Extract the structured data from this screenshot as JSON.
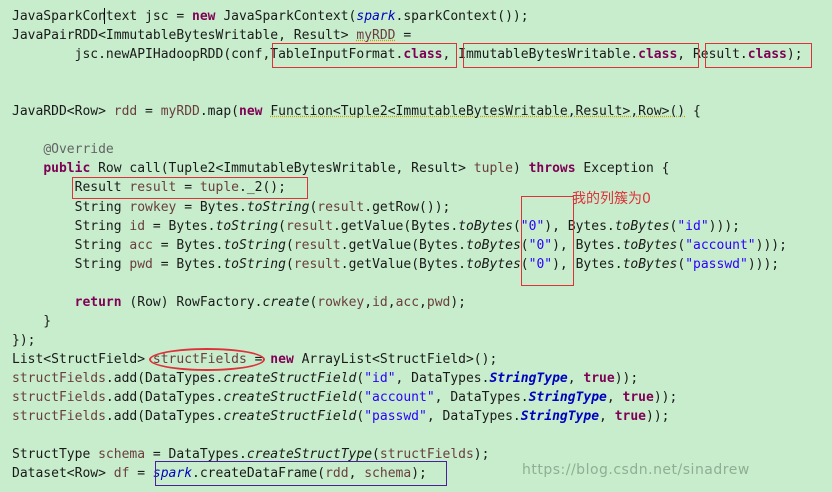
{
  "editor": {
    "lines": [
      {
        "parts": [
          {
            "t": "JavaSparkContext jsc = ",
            "c": ""
          },
          {
            "t": "new",
            "c": "kw"
          },
          {
            "t": " JavaSparkContext(",
            "c": ""
          },
          {
            "t": "spark",
            "c": "sv"
          },
          {
            "t": ".sparkContext());",
            "c": ""
          }
        ]
      },
      {
        "parts": [
          {
            "t": "JavaPairRDD<ImmutableBytesWritable, Result> ",
            "c": ""
          },
          {
            "t": "myRDD",
            "c": "var u"
          },
          {
            "t": " =",
            "c": ""
          }
        ]
      },
      {
        "parts": [
          {
            "t": "        jsc.newAPIHadoopRDD(conf,TableInputFormat.",
            "c": ""
          },
          {
            "t": "class",
            "c": "kw"
          },
          {
            "t": ", ImmutableBytesWritable.",
            "c": ""
          },
          {
            "t": "class",
            "c": "kw"
          },
          {
            "t": ", Result.",
            "c": ""
          },
          {
            "t": "class",
            "c": "kw"
          },
          {
            "t": ");",
            "c": ""
          }
        ]
      },
      {
        "parts": []
      },
      {
        "parts": []
      },
      {
        "parts": [
          {
            "t": "JavaRDD<Row> ",
            "c": ""
          },
          {
            "t": "rdd",
            "c": "var"
          },
          {
            "t": " = ",
            "c": ""
          },
          {
            "t": "myRDD",
            "c": "var"
          },
          {
            "t": ".map(",
            "c": ""
          },
          {
            "t": "new",
            "c": "kw"
          },
          {
            "t": " ",
            "c": ""
          },
          {
            "t": "Function<Tuple2<ImmutableBytesWritable,Result>,Row>()",
            "c": "u"
          },
          {
            "t": " {",
            "c": ""
          }
        ]
      },
      {
        "parts": []
      },
      {
        "parts": [
          {
            "t": "    ",
            "c": ""
          },
          {
            "t": "@Override",
            "c": "ann"
          }
        ]
      },
      {
        "parts": [
          {
            "t": "    ",
            "c": ""
          },
          {
            "t": "public",
            "c": "kw"
          },
          {
            "t": " Row call(Tuple2<ImmutableBytesWritable, Result> ",
            "c": ""
          },
          {
            "t": "tuple",
            "c": "var"
          },
          {
            "t": ") ",
            "c": ""
          },
          {
            "t": "throws",
            "c": "kw"
          },
          {
            "t": " Exception {",
            "c": ""
          }
        ]
      },
      {
        "parts": [
          {
            "t": "        Result ",
            "c": ""
          },
          {
            "t": "result",
            "c": "var"
          },
          {
            "t": " = ",
            "c": ""
          },
          {
            "t": "tuple",
            "c": "var"
          },
          {
            "t": "._2();",
            "c": ""
          }
        ]
      },
      {
        "parts": [
          {
            "t": "        String ",
            "c": ""
          },
          {
            "t": "rowkey",
            "c": "var"
          },
          {
            "t": " = Bytes.",
            "c": ""
          },
          {
            "t": "toString",
            "c": "it"
          },
          {
            "t": "(",
            "c": ""
          },
          {
            "t": "result",
            "c": "var"
          },
          {
            "t": ".getRow());",
            "c": ""
          }
        ]
      },
      {
        "parts": [
          {
            "t": "        String ",
            "c": ""
          },
          {
            "t": "id",
            "c": "var"
          },
          {
            "t": " = Bytes.",
            "c": ""
          },
          {
            "t": "toString",
            "c": "it"
          },
          {
            "t": "(",
            "c": ""
          },
          {
            "t": "result",
            "c": "var"
          },
          {
            "t": ".getValue(Bytes.",
            "c": ""
          },
          {
            "t": "toBytes",
            "c": "it"
          },
          {
            "t": "(",
            "c": ""
          },
          {
            "t": "\"0\"",
            "c": "str"
          },
          {
            "t": "), Bytes.",
            "c": ""
          },
          {
            "t": "toBytes",
            "c": "it"
          },
          {
            "t": "(",
            "c": ""
          },
          {
            "t": "\"id\"",
            "c": "str"
          },
          {
            "t": ")));",
            "c": ""
          }
        ]
      },
      {
        "parts": [
          {
            "t": "        String ",
            "c": ""
          },
          {
            "t": "acc",
            "c": "var"
          },
          {
            "t": " = Bytes.",
            "c": ""
          },
          {
            "t": "toString",
            "c": "it"
          },
          {
            "t": "(",
            "c": ""
          },
          {
            "t": "result",
            "c": "var"
          },
          {
            "t": ".getValue(Bytes.",
            "c": ""
          },
          {
            "t": "toBytes",
            "c": "it"
          },
          {
            "t": "(",
            "c": ""
          },
          {
            "t": "\"0\"",
            "c": "str"
          },
          {
            "t": "), Bytes.",
            "c": ""
          },
          {
            "t": "toBytes",
            "c": "it"
          },
          {
            "t": "(",
            "c": ""
          },
          {
            "t": "\"account\"",
            "c": "str"
          },
          {
            "t": ")));",
            "c": ""
          }
        ]
      },
      {
        "parts": [
          {
            "t": "        String ",
            "c": ""
          },
          {
            "t": "pwd",
            "c": "var"
          },
          {
            "t": " = Bytes.",
            "c": ""
          },
          {
            "t": "toString",
            "c": "it"
          },
          {
            "t": "(",
            "c": ""
          },
          {
            "t": "result",
            "c": "var"
          },
          {
            "t": ".getValue(Bytes.",
            "c": ""
          },
          {
            "t": "toBytes",
            "c": "it"
          },
          {
            "t": "(",
            "c": ""
          },
          {
            "t": "\"0\"",
            "c": "str"
          },
          {
            "t": "), Bytes.",
            "c": ""
          },
          {
            "t": "toBytes",
            "c": "it"
          },
          {
            "t": "(",
            "c": ""
          },
          {
            "t": "\"passwd\"",
            "c": "str"
          },
          {
            "t": ")));",
            "c": ""
          }
        ]
      },
      {
        "parts": []
      },
      {
        "parts": [
          {
            "t": "        ",
            "c": ""
          },
          {
            "t": "return",
            "c": "kw"
          },
          {
            "t": " (Row) RowFactory.",
            "c": ""
          },
          {
            "t": "create",
            "c": "it"
          },
          {
            "t": "(",
            "c": ""
          },
          {
            "t": "rowkey",
            "c": "var"
          },
          {
            "t": ",",
            "c": ""
          },
          {
            "t": "id",
            "c": "var"
          },
          {
            "t": ",",
            "c": ""
          },
          {
            "t": "acc",
            "c": "var"
          },
          {
            "t": ",",
            "c": ""
          },
          {
            "t": "pwd",
            "c": "var"
          },
          {
            "t": ");",
            "c": ""
          }
        ]
      },
      {
        "parts": [
          {
            "t": "    }",
            "c": ""
          }
        ]
      },
      {
        "parts": [
          {
            "t": "});",
            "c": ""
          }
        ]
      },
      {
        "parts": [
          {
            "t": "List<StructField> ",
            "c": ""
          },
          {
            "t": "structFields",
            "c": "var"
          },
          {
            "t": " = ",
            "c": ""
          },
          {
            "t": "new",
            "c": "kw"
          },
          {
            "t": " ArrayList<StructField>();",
            "c": ""
          }
        ]
      },
      {
        "parts": [
          {
            "t": "structFields",
            "c": "var"
          },
          {
            "t": ".add(DataTypes.",
            "c": ""
          },
          {
            "t": "createStructField",
            "c": "it"
          },
          {
            "t": "(",
            "c": ""
          },
          {
            "t": "\"id\"",
            "c": "str"
          },
          {
            "t": ", DataTypes.",
            "c": ""
          },
          {
            "t": "StringType",
            "c": "fld"
          },
          {
            "t": ", ",
            "c": ""
          },
          {
            "t": "true",
            "c": "kw"
          },
          {
            "t": "));",
            "c": ""
          }
        ]
      },
      {
        "parts": [
          {
            "t": "structFields",
            "c": "var"
          },
          {
            "t": ".add(DataTypes.",
            "c": ""
          },
          {
            "t": "createStructField",
            "c": "it"
          },
          {
            "t": "(",
            "c": ""
          },
          {
            "t": "\"account\"",
            "c": "str"
          },
          {
            "t": ", DataTypes.",
            "c": ""
          },
          {
            "t": "StringType",
            "c": "fld"
          },
          {
            "t": ", ",
            "c": ""
          },
          {
            "t": "true",
            "c": "kw"
          },
          {
            "t": "));",
            "c": ""
          }
        ]
      },
      {
        "parts": [
          {
            "t": "structFields",
            "c": "var"
          },
          {
            "t": ".add(DataTypes.",
            "c": ""
          },
          {
            "t": "createStructField",
            "c": "it"
          },
          {
            "t": "(",
            "c": ""
          },
          {
            "t": "\"passwd\"",
            "c": "str"
          },
          {
            "t": ", DataTypes.",
            "c": ""
          },
          {
            "t": "StringType",
            "c": "fld"
          },
          {
            "t": ", ",
            "c": ""
          },
          {
            "t": "true",
            "c": "kw"
          },
          {
            "t": "));",
            "c": ""
          }
        ]
      },
      {
        "parts": []
      },
      {
        "parts": [
          {
            "t": "StructType ",
            "c": ""
          },
          {
            "t": "schema",
            "c": "var"
          },
          {
            "t": " = DataTypes.",
            "c": ""
          },
          {
            "t": "createStructType",
            "c": "it"
          },
          {
            "t": "(",
            "c": ""
          },
          {
            "t": "structFields",
            "c": "var"
          },
          {
            "t": ");",
            "c": ""
          }
        ]
      },
      {
        "parts": [
          {
            "t": "Dataset<Row> ",
            "c": ""
          },
          {
            "t": "df",
            "c": "var"
          },
          {
            "t": " = ",
            "c": ""
          },
          {
            "t": "spark",
            "c": "sv"
          },
          {
            "t": ".createDataFrame(",
            "c": ""
          },
          {
            "t": "rdd",
            "c": "var"
          },
          {
            "t": ", ",
            "c": ""
          },
          {
            "t": "schema",
            "c": "var"
          },
          {
            "t": ");",
            "c": ""
          }
        ]
      }
    ]
  },
  "annotation": {
    "note": "我的列簇为0",
    "watermark": "https://blog.csdn.net/sinadrew"
  },
  "colors": {
    "background": "#c7edcc",
    "keyword": "#7f0055",
    "string": "#2a00ff",
    "variable": "#6a3e3e",
    "annotation_box": "#e0303a",
    "selection_box": "#4b1f9c"
  }
}
